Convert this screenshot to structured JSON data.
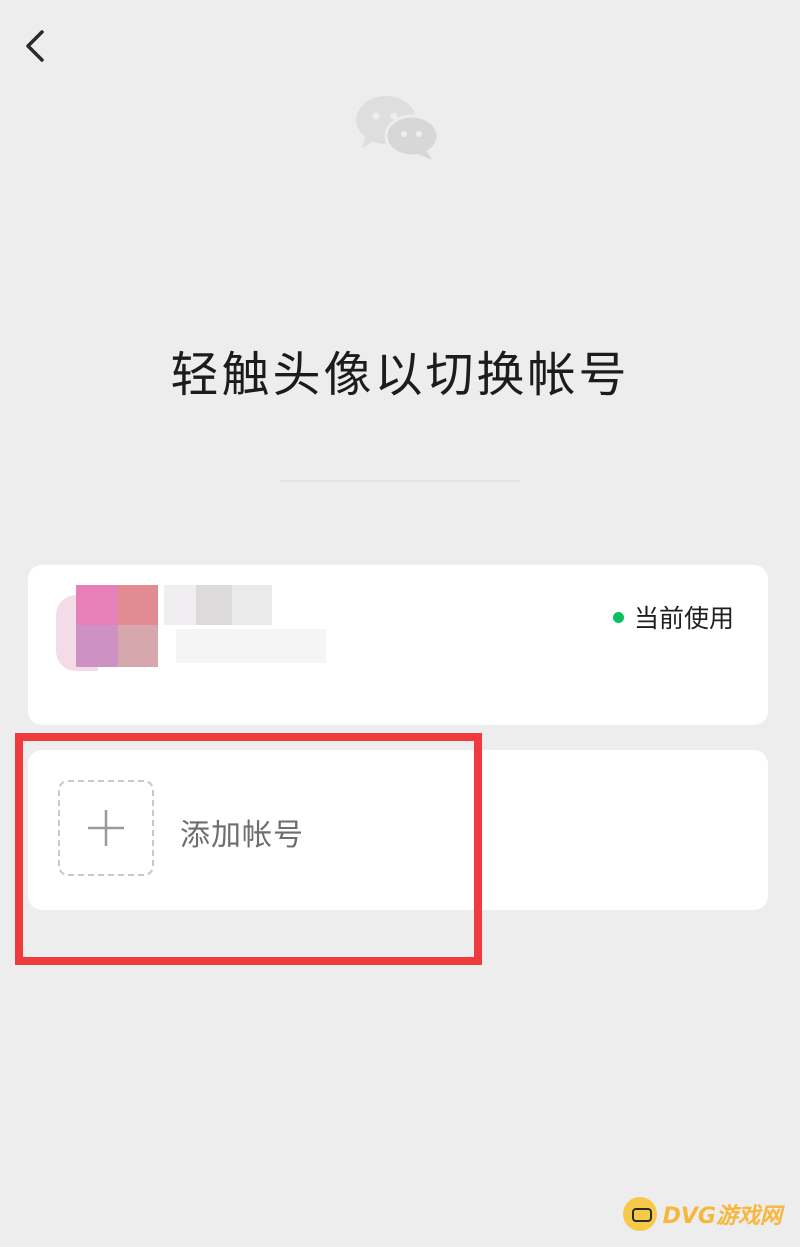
{
  "header": {
    "back_icon": "chevron-left-icon",
    "logo_icon": "wechat-logo-icon"
  },
  "title": "轻触头像以切换帐号",
  "current_account": {
    "status_label": "当前使用",
    "status_color": "#07c160"
  },
  "add_account": {
    "icon": "plus-icon",
    "label": "添加帐号"
  },
  "annotation": {
    "highlight_color": "#ef3b3d"
  },
  "watermark": {
    "text": "DVG游戏网"
  }
}
